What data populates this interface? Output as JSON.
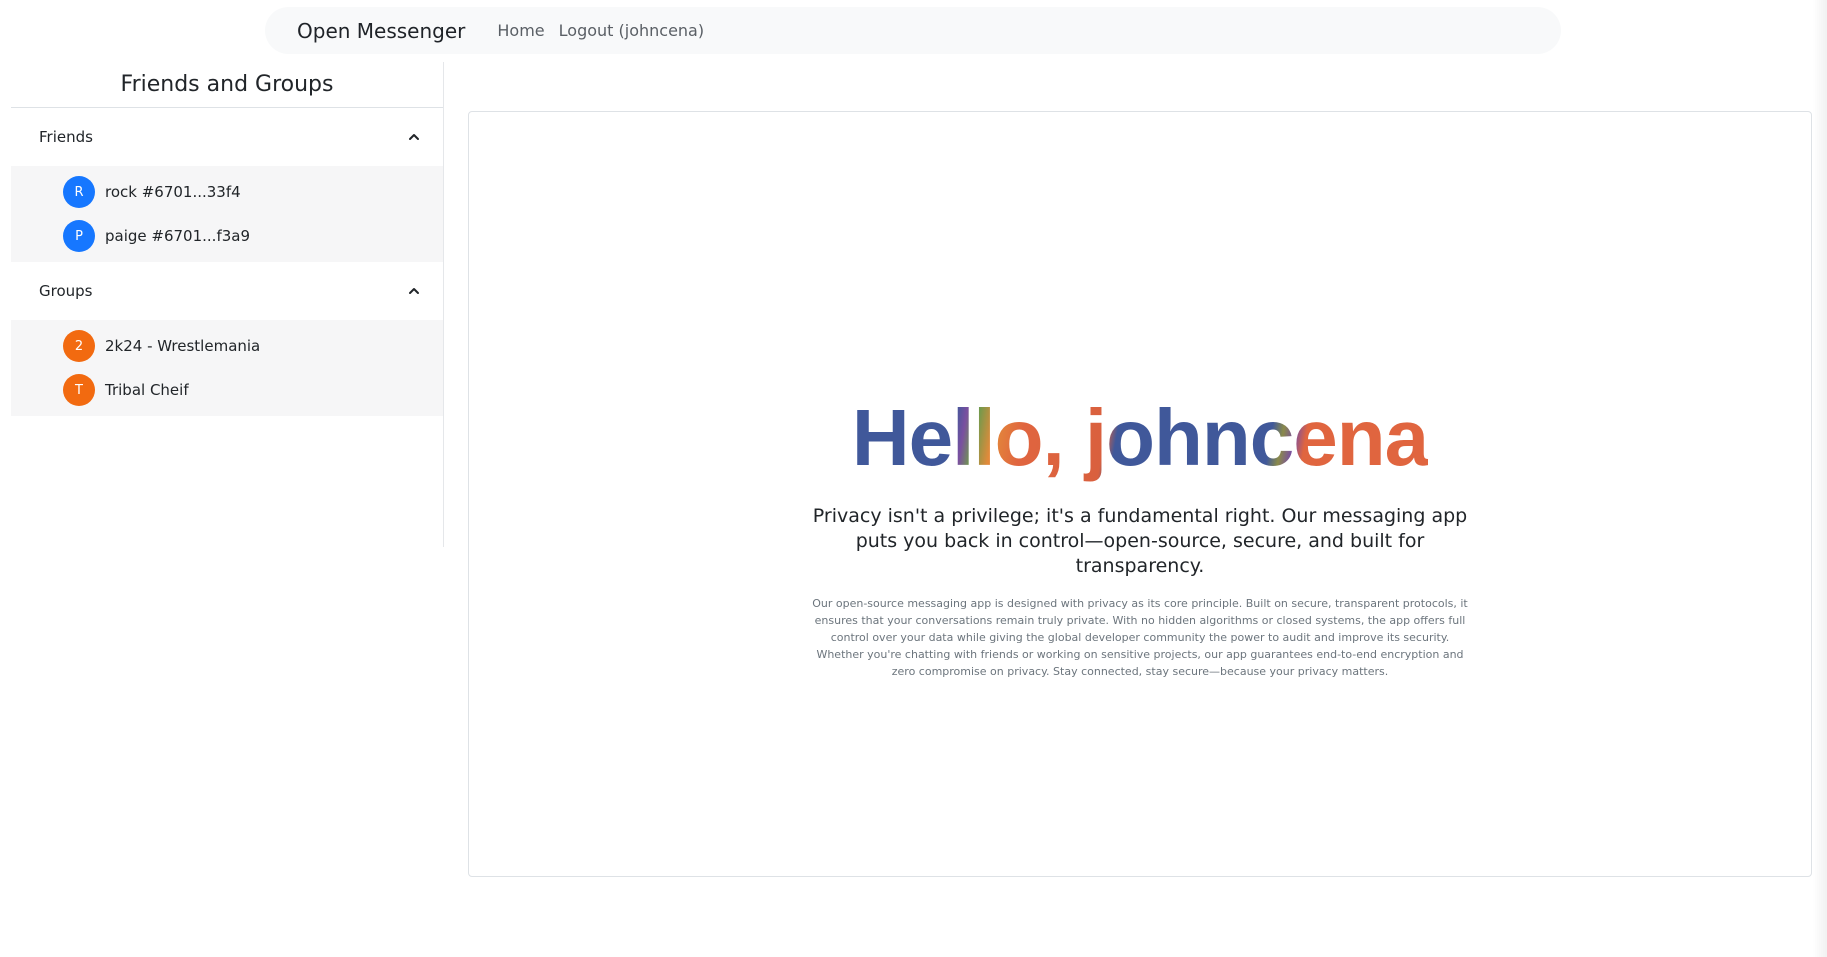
{
  "navbar": {
    "brand": "Open Messenger",
    "links": [
      {
        "label": "Home"
      },
      {
        "label": "Logout (johncena)"
      }
    ]
  },
  "sidebar": {
    "title": "Friends and Groups",
    "sections": [
      {
        "label": "Friends",
        "items": [
          {
            "initial": "R",
            "label": "rock #6701...33f4",
            "color": "#1677ff"
          },
          {
            "initial": "P",
            "label": "paige #6701...f3a9",
            "color": "#1677ff"
          }
        ]
      },
      {
        "label": "Groups",
        "items": [
          {
            "initial": "2",
            "label": "2k24 - Wrestlemania",
            "color": "#f26a10"
          },
          {
            "initial": "T",
            "label": "Tribal Cheif",
            "color": "#f26a10"
          }
        ]
      }
    ]
  },
  "main": {
    "greeting": "Hello, johncena",
    "tagline": "Privacy isn't a privilege; it's a fundamental right. Our messaging app puts you back in control—open-source, secure, and built for transparency.",
    "description": "Our open-source messaging app is designed with privacy as its core principle. Built on secure, transparent protocols, it ensures that your conversations remain truly private. With no hidden algorithms or closed systems, the app offers full control over your data while giving the global developer community the power to audit and improve its security. Whether you're chatting with friends or working on sensitive projects, our app guarantees end-to-end encryption and zero compromise on privacy. Stay connected, stay secure—because your privacy matters."
  },
  "colors": {
    "avatar_friend": "#1677ff",
    "avatar_group": "#f26a10",
    "greeting_blue": "#40589a",
    "greeting_orange": "#e0653f"
  }
}
